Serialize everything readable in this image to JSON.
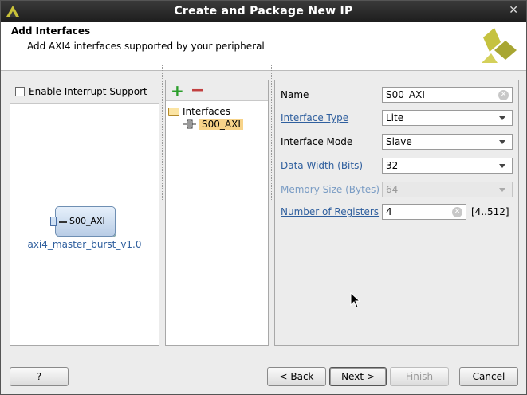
{
  "window": {
    "title": "Create and Package New IP"
  },
  "header": {
    "title": "Add Interfaces",
    "subtitle": "Add AXI4 interfaces supported by your peripheral"
  },
  "left_panel": {
    "interrupt_label": "Enable Interrupt Support",
    "interrupt_checked": false,
    "block_port": "S00_AXI",
    "block_name": "axi4_master_burst_v1.0"
  },
  "tree": {
    "root": "Interfaces",
    "child": "S00_AXI"
  },
  "properties": {
    "name_label": "Name",
    "name_value": "S00_AXI",
    "interface_type_label": "Interface Type",
    "interface_type_value": "Lite",
    "interface_mode_label": "Interface Mode",
    "interface_mode_value": "Slave",
    "data_width_label": "Data Width (Bits)",
    "data_width_value": "32",
    "memory_size_label": "Memory Size (Bytes)",
    "memory_size_value": "64",
    "num_registers_label": "Number of Registers",
    "num_registers_value": "4",
    "num_registers_range": "[4..512]"
  },
  "buttons": {
    "help": "?",
    "back": "< Back",
    "next": "Next >",
    "finish": "Finish",
    "cancel": "Cancel"
  },
  "colors": {
    "link": "#2f5f9e",
    "selection": "#f7d389",
    "add": "#2b9e2b",
    "remove": "#c24040"
  }
}
